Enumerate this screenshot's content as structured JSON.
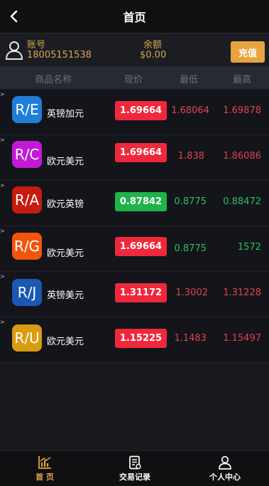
{
  "header": {
    "title": "首页"
  },
  "account": {
    "account_label": "账号",
    "account_value": "18005151538",
    "balance_label": "余额",
    "balance_value": "$0.00",
    "recharge_label": "充值"
  },
  "table": {
    "columns": [
      "商品名称",
      "现价",
      "最低",
      "最高"
    ],
    "rows": [
      {
        "symbol": "R/E",
        "logo_color": "#1e7fd6",
        "name": "英镑加元",
        "price": "1.69664",
        "price_color": "#f0283b",
        "low": "1.68064",
        "low_color": "#e0414f",
        "high": "1.69878",
        "high_color": "#e0414f"
      },
      {
        "symbol": "R/C",
        "logo_color": "#c21ad6",
        "name": "欧元美元",
        "price": "1.69664",
        "price_color": "#f0283b",
        "low": "1.838",
        "low_color": "#e0414f",
        "high": "1.86086",
        "high_color": "#e0414f"
      },
      {
        "symbol": "R/A",
        "logo_color": "#c41c10",
        "name": "欧元英镑",
        "price": "0.87842",
        "price_color": "#1fb34a",
        "low": "0.8775",
        "low_color": "#2fbf5b",
        "high": "0.88472",
        "high_color": "#2fbf5b"
      },
      {
        "symbol": "R/G",
        "logo_color": "#f0560e",
        "name": "欧元美元",
        "price": "1.69664",
        "price_color": "#f0283b",
        "low": "0.8775",
        "low_color": "#2fbf5b",
        "high": "1572",
        "high_color": "#2fbf5b"
      },
      {
        "symbol": "R/J",
        "logo_color": "#1b58b4",
        "name": "英镑美元",
        "price": "1.31172",
        "price_color": "#f0283b",
        "low": "1.3002",
        "low_color": "#e0414f",
        "high": "1.31228",
        "high_color": "#e0414f"
      },
      {
        "symbol": "R/U",
        "logo_color": "#d99b12",
        "name": "欧元美元",
        "price": "1.15225",
        "price_color": "#f0283b",
        "low": "1.1483",
        "low_color": "#e0414f",
        "high": "1.15497",
        "high_color": "#e0414f"
      }
    ]
  },
  "tabbar": {
    "items": [
      {
        "label": "首 页",
        "icon": "chart-icon",
        "color": "#e8a43c"
      },
      {
        "label": "交易记录",
        "icon": "document-icon",
        "color": "#ffffff"
      },
      {
        "label": "个人中心",
        "icon": "user-icon",
        "color": "#ffffff"
      }
    ]
  }
}
